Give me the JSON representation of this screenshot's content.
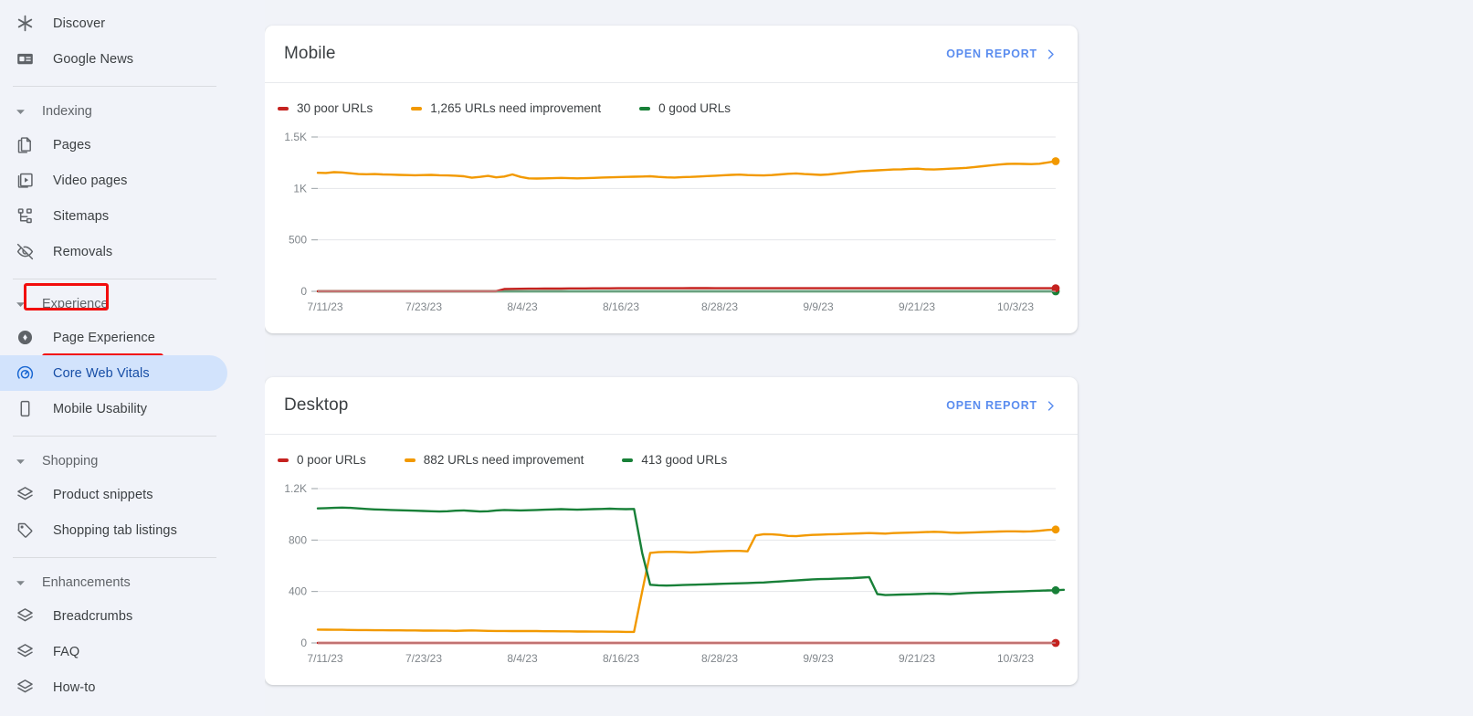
{
  "sidebar": {
    "items": [
      {
        "id": "discover",
        "label": "Discover",
        "icon": "asterisk-icon",
        "type": "item"
      },
      {
        "id": "google-news",
        "label": "Google News",
        "icon": "news-card-icon",
        "type": "item"
      },
      {
        "id": "divider-1",
        "type": "divider"
      },
      {
        "id": "indexing",
        "label": "Indexing",
        "icon": "caret-down-icon",
        "type": "group"
      },
      {
        "id": "pages",
        "label": "Pages",
        "icon": "pages-icon",
        "type": "item"
      },
      {
        "id": "video-pages",
        "label": "Video pages",
        "icon": "video-icon",
        "type": "item"
      },
      {
        "id": "sitemaps",
        "label": "Sitemaps",
        "icon": "sitemap-icon",
        "type": "item"
      },
      {
        "id": "removals",
        "label": "Removals",
        "icon": "eye-off-icon",
        "type": "item"
      },
      {
        "id": "divider-2",
        "type": "divider"
      },
      {
        "id": "experience",
        "label": "Experience",
        "icon": "caret-down-icon",
        "type": "group",
        "highlighted": true
      },
      {
        "id": "page-experience",
        "label": "Page Experience",
        "icon": "page-experience-icon",
        "type": "item"
      },
      {
        "id": "core-web-vitals",
        "label": "Core Web Vitals",
        "icon": "speedometer-icon",
        "type": "item",
        "selected": true,
        "highlighted": true
      },
      {
        "id": "mobile-usability",
        "label": "Mobile Usability",
        "icon": "mobile-phone-icon",
        "type": "item"
      },
      {
        "id": "divider-3",
        "type": "divider"
      },
      {
        "id": "shopping",
        "label": "Shopping",
        "icon": "caret-down-icon",
        "type": "group"
      },
      {
        "id": "product-snippets",
        "label": "Product snippets",
        "icon": "layers-icon",
        "type": "item"
      },
      {
        "id": "shopping-tab",
        "label": "Shopping tab listings",
        "icon": "tag-icon",
        "type": "item"
      },
      {
        "id": "divider-4",
        "type": "divider"
      },
      {
        "id": "enhancements",
        "label": "Enhancements",
        "icon": "caret-down-icon",
        "type": "group"
      },
      {
        "id": "breadcrumbs",
        "label": "Breadcrumbs",
        "icon": "layers-icon",
        "type": "item"
      },
      {
        "id": "faq",
        "label": "FAQ",
        "icon": "layers-icon",
        "type": "item"
      },
      {
        "id": "how-to",
        "label": "How-to",
        "icon": "layers-icon",
        "type": "item"
      }
    ]
  },
  "colors": {
    "poor": "#c5221f",
    "needs_improvement": "#f29900",
    "good": "#188038",
    "accent_link": "#5b8def",
    "selected_pill": "#d2e3fc",
    "annotation_box": "#f20d0d"
  },
  "cards": [
    {
      "id": "mobile",
      "title": "Mobile",
      "open_report_label": "OPEN REPORT",
      "open_report_icon": "chevron-right-icon"
    },
    {
      "id": "desktop",
      "title": "Desktop",
      "open_report_label": "OPEN REPORT",
      "open_report_icon": "chevron-right-icon"
    }
  ],
  "chart_data": [
    {
      "id": "mobile",
      "type": "line",
      "title": "Mobile",
      "xlabel": "",
      "ylabel": "",
      "ylim": [
        0,
        1500
      ],
      "yticks": [
        0,
        500,
        1000,
        1500
      ],
      "ytick_labels": [
        "0",
        "500",
        "1K",
        "1.5K"
      ],
      "grid": true,
      "legend_position": "top-left",
      "x": [
        "7/11/23",
        "7/23/23",
        "8/4/23",
        "8/16/23",
        "8/28/23",
        "9/9/23",
        "9/21/23",
        "10/3/23"
      ],
      "xtick_labels": [
        "7/11/23",
        "7/23/23",
        "8/4/23",
        "8/16/23",
        "8/28/23",
        "9/9/23",
        "9/21/23",
        "10/3/23"
      ],
      "series": [
        {
          "name": "30 poor URLs",
          "legend_label": "30 poor URLs",
          "color": "#c5221f",
          "final_value": 30,
          "values": [
            1,
            1,
            1,
            1,
            1,
            1,
            1,
            1,
            1,
            1,
            1,
            1,
            1,
            1,
            1,
            1,
            1,
            1,
            1,
            1,
            1,
            1,
            1,
            22,
            24,
            25,
            26,
            26,
            27,
            27,
            27,
            28,
            28,
            28,
            29,
            29,
            29,
            30,
            30,
            30,
            30,
            30,
            30,
            30,
            30,
            30,
            31,
            31,
            31,
            30,
            30,
            30,
            30,
            30,
            30,
            30,
            30,
            30,
            30,
            30,
            30,
            30,
            30,
            30,
            30,
            30,
            30,
            30,
            30,
            30,
            30,
            30,
            30,
            30,
            30,
            30,
            30,
            30,
            30,
            30,
            30,
            30,
            30,
            30,
            30,
            30,
            30,
            30,
            30,
            30,
            30,
            30
          ]
        },
        {
          "name": "1,265 URLs need improvement",
          "legend_label": "1,265 URLs need improvement",
          "color": "#f29900",
          "final_value": 1265,
          "values": [
            1152,
            1150,
            1158,
            1156,
            1148,
            1140,
            1138,
            1140,
            1136,
            1134,
            1132,
            1130,
            1128,
            1130,
            1132,
            1128,
            1126,
            1124,
            1118,
            1104,
            1112,
            1122,
            1108,
            1116,
            1136,
            1112,
            1098,
            1096,
            1098,
            1100,
            1102,
            1100,
            1098,
            1100,
            1102,
            1106,
            1108,
            1110,
            1112,
            1114,
            1116,
            1118,
            1112,
            1108,
            1106,
            1110,
            1112,
            1116,
            1120,
            1124,
            1128,
            1132,
            1134,
            1130,
            1128,
            1126,
            1130,
            1136,
            1142,
            1146,
            1140,
            1136,
            1132,
            1136,
            1144,
            1152,
            1160,
            1168,
            1172,
            1176,
            1180,
            1184,
            1186,
            1190,
            1192,
            1186,
            1184,
            1188,
            1192,
            1196,
            1200,
            1208,
            1216,
            1224,
            1232,
            1238,
            1240,
            1238,
            1236,
            1240,
            1252,
            1265
          ]
        },
        {
          "name": "0 good URLs",
          "legend_label": "0 good URLs",
          "color": "#188038",
          "final_value": 0,
          "values": [
            0,
            0,
            0,
            0,
            0,
            0,
            0,
            0,
            0,
            0,
            0,
            0,
            0,
            0,
            0,
            0,
            0,
            0,
            0,
            0,
            0,
            0,
            0,
            0,
            0,
            0,
            0,
            0,
            0,
            0,
            0,
            0,
            0,
            0,
            0,
            0,
            0,
            0,
            0,
            0,
            0,
            0,
            0,
            0,
            0,
            0,
            0,
            0,
            0,
            0,
            0,
            0,
            0,
            0,
            0,
            0,
            0,
            0,
            0,
            0,
            0,
            0,
            0,
            0,
            0,
            0,
            0,
            0,
            0,
            0,
            0,
            0,
            0,
            0,
            0,
            0,
            0,
            0,
            0,
            0,
            0,
            0,
            0,
            0,
            0,
            0,
            0,
            0,
            0,
            0,
            0,
            0
          ]
        }
      ]
    },
    {
      "id": "desktop",
      "type": "line",
      "title": "Desktop",
      "xlabel": "",
      "ylabel": "",
      "ylim": [
        0,
        1200
      ],
      "yticks": [
        0,
        400,
        800,
        1200
      ],
      "ytick_labels": [
        "0",
        "400",
        "800",
        "1.2K"
      ],
      "grid": true,
      "legend_position": "top-left",
      "x": [
        "7/11/23",
        "7/23/23",
        "8/4/23",
        "8/16/23",
        "8/28/23",
        "9/9/23",
        "9/21/23",
        "10/3/23"
      ],
      "xtick_labels": [
        "7/11/23",
        "7/23/23",
        "8/4/23",
        "8/16/23",
        "8/28/23",
        "9/9/23",
        "9/21/23",
        "10/3/23"
      ],
      "series": [
        {
          "name": "0 poor URLs",
          "legend_label": "0 poor URLs",
          "color": "#c5221f",
          "final_value": 0,
          "values": [
            0,
            0,
            0,
            0,
            0,
            0,
            0,
            0,
            0,
            0,
            0,
            0,
            0,
            0,
            0,
            0,
            0,
            0,
            0,
            0,
            0,
            0,
            0,
            0,
            0,
            0,
            0,
            0,
            0,
            0,
            0,
            0,
            0,
            0,
            0,
            0,
            0,
            0,
            0,
            0,
            0,
            0,
            0,
            0,
            0,
            0,
            0,
            0,
            0,
            0,
            0,
            0,
            0,
            0,
            0,
            0,
            0,
            0,
            0,
            0,
            0,
            0,
            0,
            0,
            0,
            0,
            0,
            0,
            0,
            0,
            0,
            0,
            0,
            0,
            0,
            0,
            0,
            0,
            0,
            0,
            0,
            0,
            0,
            0,
            0,
            0,
            0,
            0,
            0,
            0,
            0,
            0
          ]
        },
        {
          "name": "882 URLs need improvement",
          "legend_label": "882 URLs need improvement",
          "color": "#f29900",
          "final_value": 882,
          "values": [
            104,
            103,
            102,
            102,
            101,
            100,
            100,
            99,
            99,
            98,
            98,
            97,
            97,
            96,
            96,
            95,
            95,
            94,
            96,
            97,
            95,
            94,
            93,
            93,
            92,
            93,
            92,
            92,
            91,
            91,
            90,
            90,
            89,
            89,
            88,
            88,
            87,
            87,
            86,
            86,
            400,
            700,
            706,
            708,
            708,
            706,
            704,
            706,
            710,
            712,
            714,
            716,
            716,
            712,
            836,
            846,
            844,
            840,
            832,
            830,
            836,
            840,
            842,
            844,
            846,
            848,
            850,
            852,
            854,
            852,
            850,
            854,
            856,
            858,
            860,
            862,
            864,
            862,
            858,
            856,
            858,
            860,
            862,
            864,
            866,
            868,
            868,
            866,
            868,
            872,
            878,
            882
          ]
        },
        {
          "name": "413 good URLs",
          "legend_label": "413 good URLs",
          "color": "#188038",
          "final_value": 413,
          "values": [
            1046,
            1048,
            1050,
            1052,
            1050,
            1046,
            1042,
            1038,
            1036,
            1034,
            1032,
            1030,
            1028,
            1026,
            1024,
            1022,
            1024,
            1028,
            1030,
            1026,
            1022,
            1024,
            1030,
            1034,
            1032,
            1030,
            1032,
            1034,
            1036,
            1038,
            1040,
            1038,
            1036,
            1038,
            1040,
            1042,
            1044,
            1042,
            1040,
            1042,
            700,
            452,
            448,
            446,
            448,
            450,
            452,
            454,
            456,
            458,
            460,
            462,
            464,
            466,
            468,
            470,
            474,
            478,
            482,
            486,
            490,
            494,
            496,
            498,
            500,
            502,
            504,
            508,
            512,
            380,
            372,
            374,
            376,
            378,
            380,
            382,
            384,
            382,
            380,
            384,
            388,
            390,
            392,
            394,
            396,
            398,
            400,
            402,
            404,
            406,
            408,
            410,
            413
          ]
        }
      ]
    }
  ]
}
